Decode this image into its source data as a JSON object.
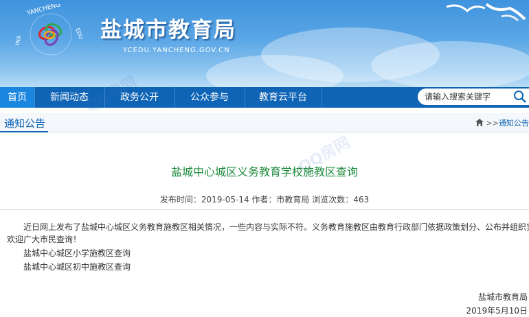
{
  "header": {
    "site_title": "盐城市教育局",
    "site_url": "YCEDU.YANCHENG.GOV.CN",
    "logo_text": "YANCHENG EDU"
  },
  "nav": {
    "items": [
      {
        "label": "首页"
      },
      {
        "label": "新闻动态"
      },
      {
        "label": "政务公开"
      },
      {
        "label": "公众参与"
      },
      {
        "label": "教育云平台"
      }
    ],
    "search_placeholder": "请输入搜索关键字"
  },
  "section": {
    "title": "通知公告",
    "breadcrumb_sep": ">>",
    "breadcrumb_link": "通知公告"
  },
  "article": {
    "title": "盐城中心城区义务教育学校施教区查询",
    "meta": "发布时间：2019-05-14 作者：市教育局 浏览次数：463",
    "paragraph_1": "近日网上发布了盐城中心城区义务教育施教区相关情况，一些内容与实际不符。义务教育施教区由教育行政部门依据政策划分、公布并组织实施，",
    "paragraph_2": "欢迎广大市民查询！",
    "links": [
      {
        "label": "盐城中心城区小学施教区查询"
      },
      {
        "label": "盐城中心城区初中施教区查询"
      }
    ],
    "sign_org": "盐城市教育局",
    "sign_date": "2019年5月10日"
  },
  "watermark": "QQ房网",
  "colors": {
    "nav_bg": "#0f64b5",
    "title_green": "#1b8a3b",
    "header_blue": "#3f93dd"
  }
}
